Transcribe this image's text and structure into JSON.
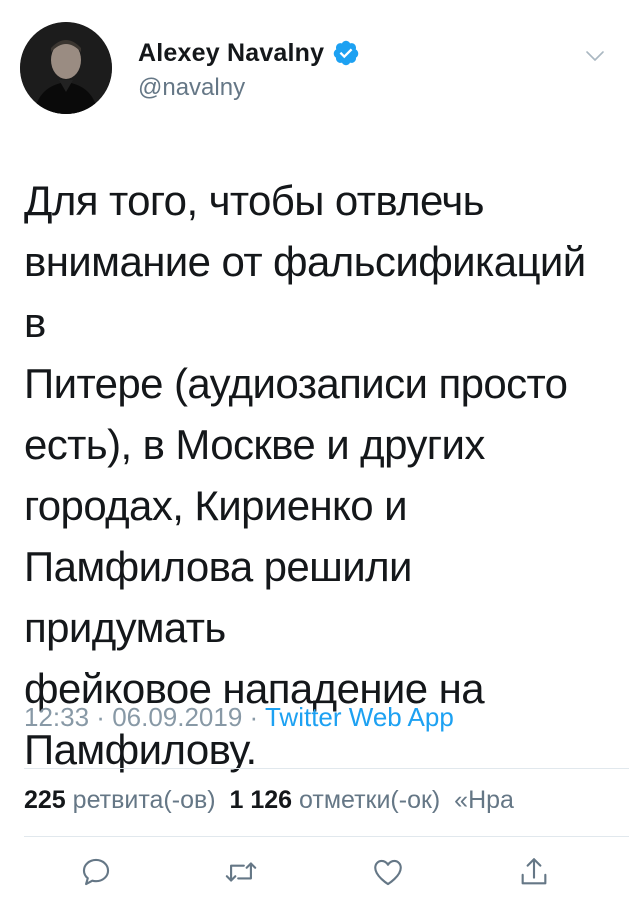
{
  "author": {
    "display_name": "Alexey Navalny",
    "handle": "@navalny",
    "verified": true
  },
  "tweet": {
    "text": "Для того, чтобы отвлечь\nвнимание от фальсификаций в\nПитере (аудиозаписи просто\nесть), в Москве и других\nгородах, Кириенко и\nПамфилова решили придумать\nфейковое нападение на\nПамфилову.",
    "time": "12:33",
    "date": "06.09.2019",
    "separator": " · ",
    "source": "Twitter Web App"
  },
  "stats": {
    "retweets": "225",
    "retweets_label": "ретвита(-ов)",
    "likes": "1 126",
    "likes_label": "отметки(-ок)",
    "quote_fragment": "«Нра"
  },
  "icons": {
    "verified": "verified-badge-icon",
    "chevron": "chevron-down-icon",
    "reply": "reply-icon",
    "retweet": "retweet-icon",
    "like": "heart-icon",
    "share": "share-icon"
  },
  "colors": {
    "accent": "#1da1f2",
    "text": "#14171a",
    "secondary": "#657786",
    "muted": "#8899a6"
  }
}
